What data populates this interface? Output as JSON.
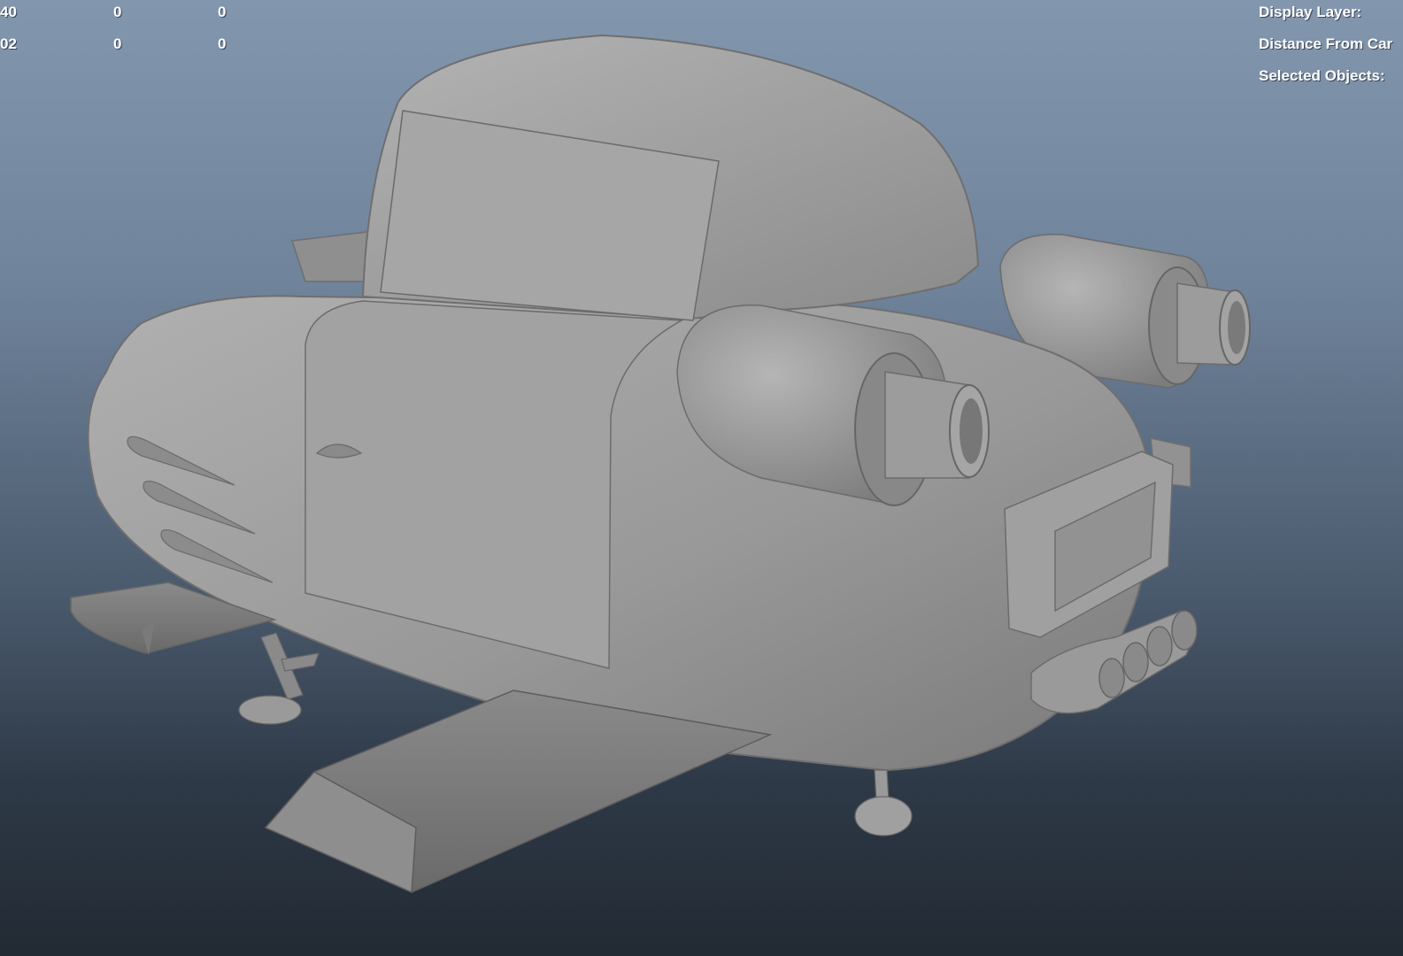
{
  "hud": {
    "left_rows": [
      [
        "40",
        "0",
        "0"
      ],
      [
        "02",
        "0",
        "0"
      ]
    ],
    "right": {
      "display_layer": "Display Layer:",
      "distance_from_camera": "Distance From Car",
      "selected_objects": "Selected Objects:"
    }
  },
  "viewport": {
    "shading": "smooth-shaded",
    "model_color": "#9a9a9a",
    "background_top": "#8296ae",
    "background_bottom": "#222a33"
  }
}
